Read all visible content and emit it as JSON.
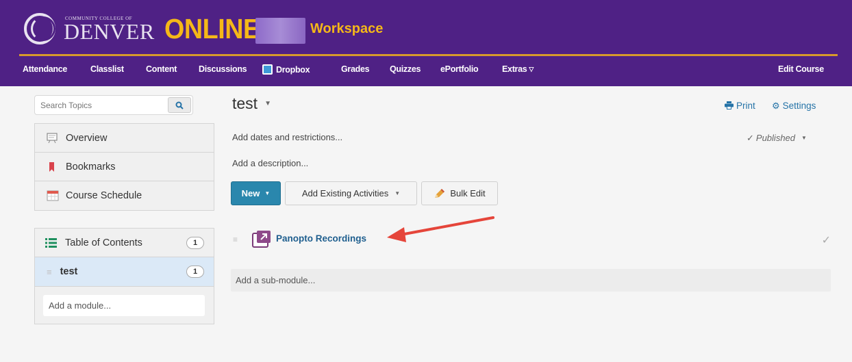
{
  "header": {
    "logo_small": "COMMUNITY COLLEGE OF",
    "logo_big": "DENVER",
    "online": "ONLINE",
    "workspace": "Workspace",
    "colors": {
      "purple": "#4f2185",
      "gold": "#f5b818"
    }
  },
  "nav": {
    "attendance": "Attendance",
    "classlist": "Classlist",
    "content": "Content",
    "discussions": "Discussions",
    "dropbox": "Dropbox",
    "grades": "Grades",
    "quizzes": "Quizzes",
    "eportfolio": "ePortfolio",
    "extras": "Extras",
    "edit_course": "Edit Course"
  },
  "sidebar": {
    "search_placeholder": "Search Topics",
    "items": [
      {
        "label": "Overview",
        "icon": "overview-icon"
      },
      {
        "label": "Bookmarks",
        "icon": "bookmark-icon"
      },
      {
        "label": "Course Schedule",
        "icon": "calendar-icon"
      }
    ],
    "toc": {
      "label": "Table of Contents",
      "count": "1"
    },
    "module": {
      "label": "test",
      "count": "1"
    },
    "add_module": "Add a module..."
  },
  "main": {
    "title": "test",
    "print": "Print",
    "settings": "Settings",
    "add_dates": "Add dates and restrictions...",
    "add_description": "Add a description...",
    "published": "Published",
    "new_button": "New",
    "add_existing": "Add Existing Activities",
    "bulk_edit": "Bulk Edit",
    "module_item": "Panopto Recordings",
    "add_submodule": "Add a sub-module..."
  }
}
